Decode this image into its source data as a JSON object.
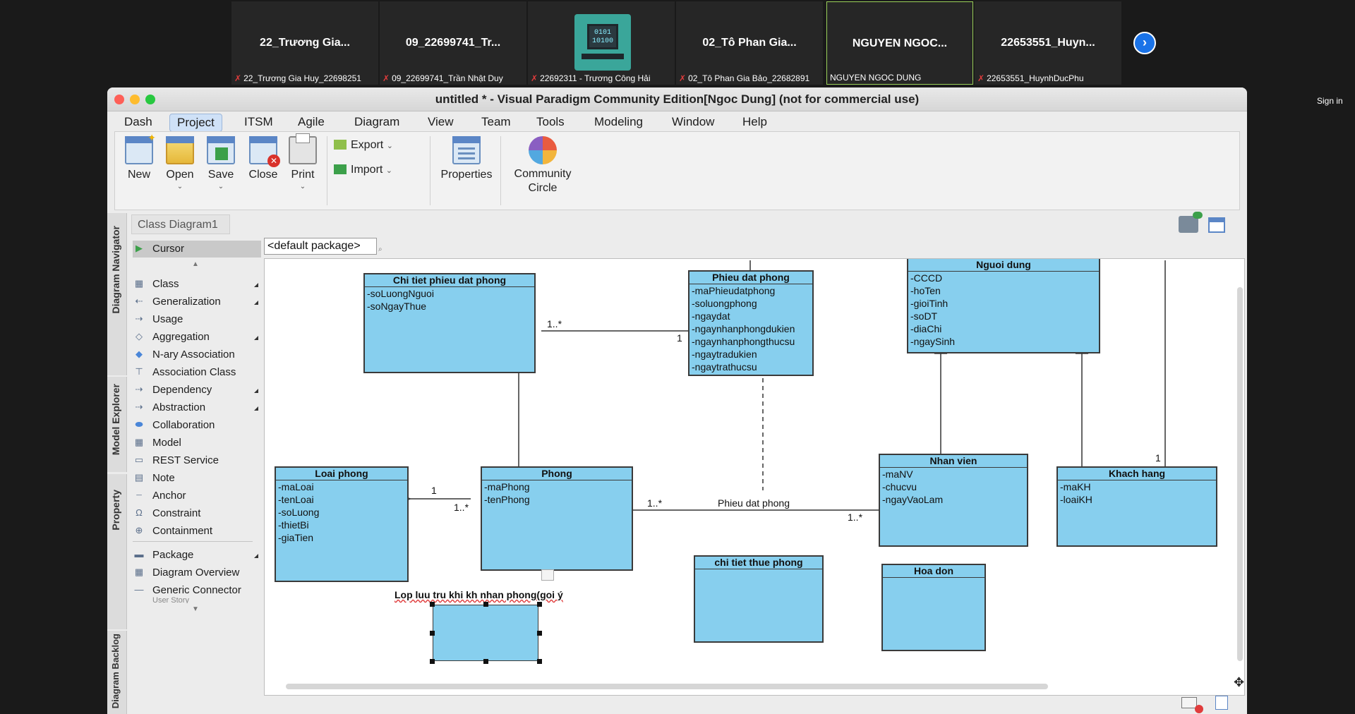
{
  "meeting": {
    "tiles": [
      {
        "name": "22_Trương Gia...",
        "footer": "22_Trương Gia Huy_22698251"
      },
      {
        "name": "09_22699741_Tr...",
        "footer": "09_22699741_Trần Nhật Duy"
      },
      {
        "name": "",
        "footer": "22692311 - Trương Công Hải"
      },
      {
        "name": "02_Tô Phan Gia...",
        "footer": "02_Tô Phan Gia Bảo_22682891"
      },
      {
        "name": "NGUYEN NGOC...",
        "footer": "NGUYEN NGOC DUNG"
      },
      {
        "name": "22653551_Huyn...",
        "footer": "22653551_HuynhDucPhu"
      }
    ],
    "sign_in": "Sign in"
  },
  "window": {
    "title": "untitled * - Visual Paradigm Community Edition[Ngoc Dung] (not for commercial use)"
  },
  "menubar": [
    "Dash",
    "Project",
    "ITSM",
    "Agile",
    "Diagram",
    "View",
    "Team",
    "Tools",
    "Modeling",
    "Window",
    "Help"
  ],
  "ribbon": {
    "new": "New",
    "open": "Open",
    "save": "Save",
    "close": "Close",
    "print": "Print",
    "export": "Export",
    "import": "Import",
    "properties": "Properties",
    "community_line1": "Community",
    "community_line2": "Circle"
  },
  "breadcrumb": "Class Diagram1",
  "package": "<default package>",
  "side_tabs": [
    "Diagram Navigator",
    "Model Explorer",
    "Property",
    "Diagram Backlog"
  ],
  "palette": {
    "cursor": "Cursor",
    "items": [
      "Class",
      "Generalization",
      "Usage",
      "Aggregation",
      "N-ary Association",
      "Association Class",
      "Dependency",
      "Abstraction",
      "Collaboration",
      "Model",
      "REST Service",
      "Note",
      "Anchor",
      "Constraint",
      "Containment",
      "Package",
      "Diagram Overview",
      "Generic Connector",
      "User Story"
    ]
  },
  "diagram": {
    "classes": {
      "chitiet": {
        "name": "Chi tiet phieu dat phong",
        "attrs": [
          "-soLuongNguoi",
          "-soNgayThue"
        ]
      },
      "phieu": {
        "name": "Phieu dat phong",
        "attrs": [
          "-maPhieudatphong",
          "-soluongphong",
          "-ngaydat",
          "-ngaynhanphongdukien",
          "-ngaynhanphongthucsu",
          "-ngaytradukien",
          "-ngaytrathucsu"
        ]
      },
      "nguoidung": {
        "name": "Nguoi dung",
        "attrs": [
          "-CCCD",
          "-hoTen",
          "-gioiTinh",
          "-soDT",
          "-diaChi",
          "-ngaySinh"
        ]
      },
      "loaiphong": {
        "name": "Loai phong",
        "attrs": [
          "-maLoai",
          "-tenLoai",
          "-soLuong",
          "-thietBi",
          "-giaTien"
        ]
      },
      "phong": {
        "name": "Phong",
        "attrs": [
          "-maPhong",
          "-tenPhong"
        ]
      },
      "nhanvien": {
        "name": "Nhan vien",
        "attrs": [
          "-maNV",
          "-chucvu",
          "-ngayVaoLam"
        ]
      },
      "khachhang": {
        "name": "Khach hang",
        "attrs": [
          "-maKH",
          "-loaiKH"
        ]
      },
      "thue": {
        "name": "chi tiet thue phong",
        "attrs": []
      },
      "hoadon": {
        "name": "Hoa don",
        "attrs": []
      }
    },
    "editing_label": "Lop luu tru khi kh nhan phong(goi ý",
    "association_label": "Phieu dat phong",
    "multiplicities": {
      "chitiet_phieu_a": "1..*",
      "chitiet_phieu_b": "1",
      "loai_phong_a": "1",
      "loai_phong_b": "1..*",
      "phong_nv_a": "1..*",
      "phong_nv_b": "1..*",
      "kh_top": "1"
    }
  }
}
